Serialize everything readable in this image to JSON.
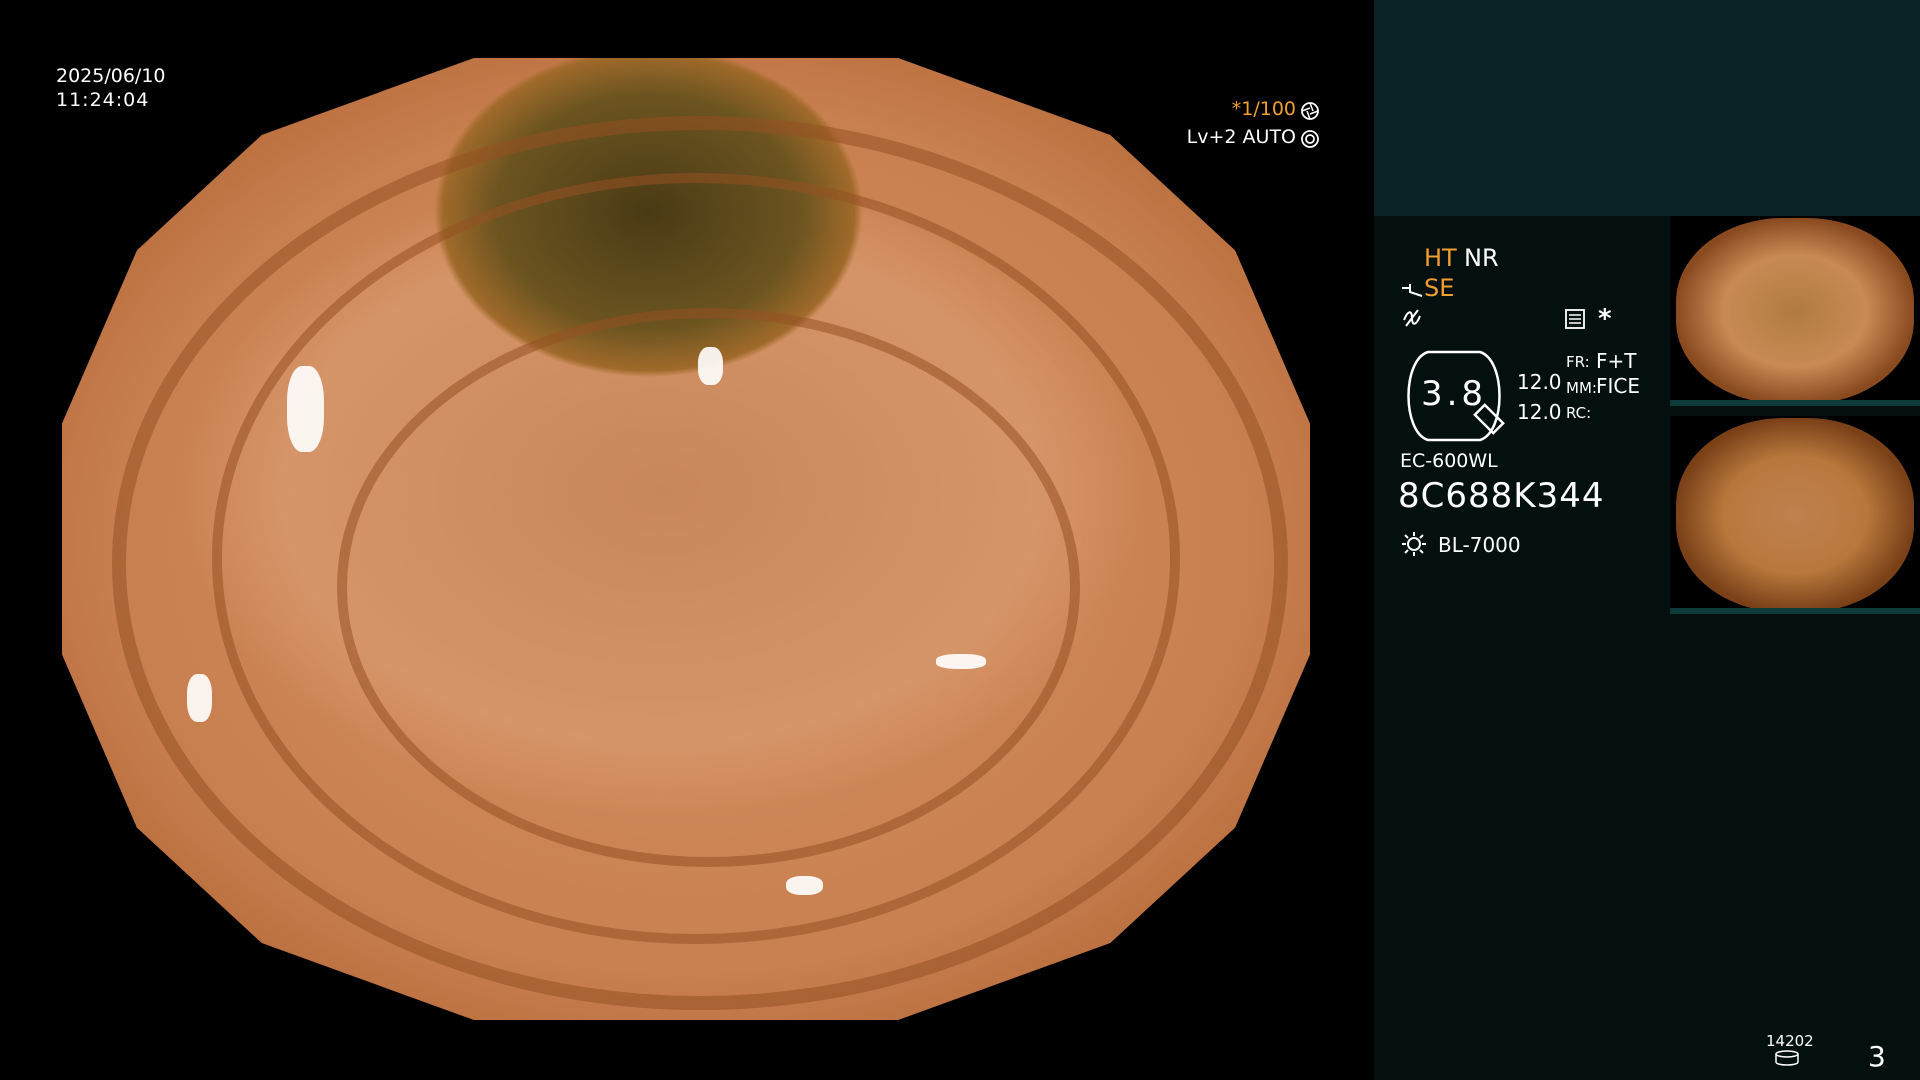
{
  "overlay": {
    "date": "2025/06/10",
    "time": "11:24:04",
    "shutter": "*1/100",
    "iris": "Lv+2 AUTO"
  },
  "panel": {
    "mode1_a": "HT",
    "mode1_b": "NR",
    "mode2": "SE",
    "zoom_value": "3.8",
    "val1": "12.0",
    "val2": "12.0",
    "fr_label": "FR:",
    "fr_value": "F+T",
    "mm_label": "MM:",
    "mm_value": "FICE",
    "rc_label": "RC:",
    "scope_model": "EC-600WL",
    "serial": "8C688K344",
    "light_source": "BL-7000",
    "image_count": "14202",
    "page_number": "3"
  },
  "icons": {
    "shutter_icon": "aperture-icon",
    "iris_icon": "iris-icon",
    "signal_icon": "signal-icon",
    "filter_icon": "filter-icon",
    "settings_icon": "list-settings-icon",
    "asterisk_icon": "asterisk-icon",
    "light_icon": "sun-icon",
    "storage_icon": "database-icon"
  },
  "colors": {
    "accent": "#f0a030",
    "panel_bg": "#040f10",
    "panel_top_bg": "#0a2224"
  }
}
